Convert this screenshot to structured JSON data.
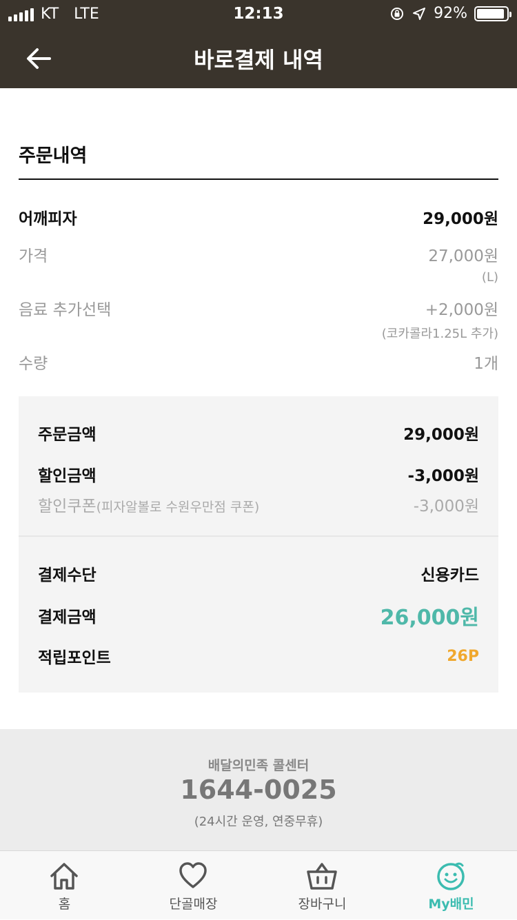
{
  "status_bar": {
    "carrier": "KT",
    "network": "LTE",
    "time": "12:13",
    "battery": "92%",
    "battery_level": 0.92
  },
  "nav": {
    "title": "바로결제 내역",
    "back_icon": "back-arrow-icon"
  },
  "order": {
    "section_title": "주문내역",
    "item_name": "어깨피자",
    "item_total": "29,000원",
    "price_label": "가격",
    "price_value": "27,000원",
    "price_option": "(L)",
    "drink_label": "음료 추가선택",
    "drink_value": "+2,000원",
    "drink_option": "(코카콜라1.25L 추가)",
    "qty_label": "수량",
    "qty_value": "1개"
  },
  "summary": {
    "order_amount_label": "주문금액",
    "order_amount_value": "29,000원",
    "discount_label": "할인금액",
    "discount_value": "-3,000원",
    "coupon_label": "할인쿠폰",
    "coupon_detail": "(피자알볼로 수원우만점 쿠폰)",
    "coupon_value": "-3,000원",
    "payment_method_label": "결제수단",
    "payment_method_value": "신용카드",
    "paid_amount_label": "결제금액",
    "paid_amount_value": "26,000원",
    "points_label": "적립포인트",
    "points_value": "26P"
  },
  "footer": {
    "title": "배달의민족 콜센터",
    "phone": "1644-0025",
    "note": "(24시간 운영, 연중무휴)"
  },
  "tabs": [
    {
      "label": "홈",
      "icon": "home-icon"
    },
    {
      "label": "단골매장",
      "icon": "heart-icon"
    },
    {
      "label": "장바구니",
      "icon": "basket-icon"
    },
    {
      "label": "My배민",
      "icon": "smiley-icon",
      "active": true
    }
  ],
  "colors": {
    "header_bg": "#3a342c",
    "accent_teal": "#4fb8a9",
    "points_orange": "#f0a82e"
  }
}
